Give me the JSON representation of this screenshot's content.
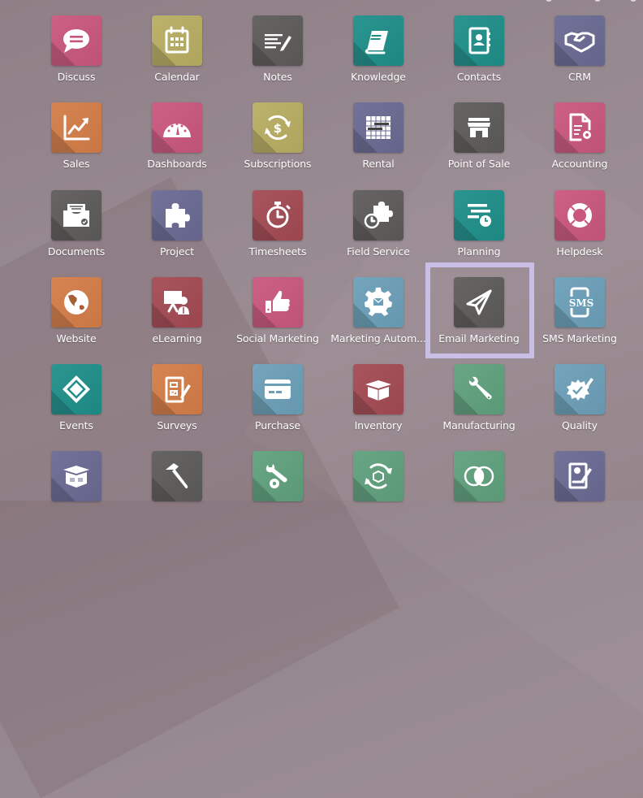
{
  "page": "Odoo app launcher",
  "highlighted_app": "Email Marketing",
  "highlight_color": "#c9bfe6",
  "apps": [
    {
      "label": "Discuss",
      "icon": "chat-bubble-icon",
      "color": "#c9577d"
    },
    {
      "label": "Calendar",
      "icon": "calendar-icon",
      "color": "#b8ad62"
    },
    {
      "label": "Notes",
      "icon": "notes-pencil-icon",
      "color": "#5d5b59"
    },
    {
      "label": "Knowledge",
      "icon": "book-icon",
      "color": "#1e8e89"
    },
    {
      "label": "Contacts",
      "icon": "address-book-icon",
      "color": "#1e8e89"
    },
    {
      "label": "CRM",
      "icon": "handshake-icon",
      "color": "#6a6a93"
    },
    {
      "label": "Sales",
      "icon": "chart-up-icon",
      "color": "#d37d47"
    },
    {
      "label": "Dashboards",
      "icon": "gauge-icon",
      "color": "#c9577d"
    },
    {
      "label": "Subscriptions",
      "icon": "recurring-dollar-icon",
      "color": "#b8ad62"
    },
    {
      "label": "Rental",
      "icon": "gantt-icon",
      "color": "#6a6a93"
    },
    {
      "label": "Point of Sale",
      "icon": "shop-icon",
      "color": "#5d5b59"
    },
    {
      "label": "Accounting",
      "icon": "document-gear-icon",
      "color": "#c9577d"
    },
    {
      "label": "Documents",
      "icon": "inbox-tray-icon",
      "color": "#5d5b59"
    },
    {
      "label": "Project",
      "icon": "puzzle-icon",
      "color": "#6a6a93"
    },
    {
      "label": "Timesheets",
      "icon": "stopwatch-icon",
      "color": "#a34a53"
    },
    {
      "label": "Field Service",
      "icon": "puzzle-stopwatch-icon",
      "color": "#5d5b59"
    },
    {
      "label": "Planning",
      "icon": "planning-lines-icon",
      "color": "#1e8e89"
    },
    {
      "label": "Helpdesk",
      "icon": "lifebuoy-icon",
      "color": "#c9577d"
    },
    {
      "label": "Website",
      "icon": "globe-icon",
      "color": "#d37d47"
    },
    {
      "label": "eLearning",
      "icon": "presentation-icon",
      "color": "#a34a53"
    },
    {
      "label": "Social Marketing",
      "icon": "thumbs-up-icon",
      "color": "#c9577d"
    },
    {
      "label": "Marketing Autom...",
      "icon": "gear-envelope-icon",
      "color": "#6b9fb8"
    },
    {
      "label": "Email Marketing",
      "icon": "paper-plane-icon",
      "color": "#5d5b59"
    },
    {
      "label": "SMS Marketing",
      "icon": "sms-phone-icon",
      "color": "#6b9fb8"
    },
    {
      "label": "Events",
      "icon": "ticket-icon",
      "color": "#1e8e89"
    },
    {
      "label": "Surveys",
      "icon": "checklist-pencil-icon",
      "color": "#d37d47"
    },
    {
      "label": "Purchase",
      "icon": "credit-card-icon",
      "color": "#6b9fb8"
    },
    {
      "label": "Inventory",
      "icon": "open-box-icon",
      "color": "#a34a53"
    },
    {
      "label": "Manufacturing",
      "icon": "wrench-icon",
      "color": "#5fa07d"
    },
    {
      "label": "Quality",
      "icon": "badge-check-pencil-icon",
      "color": "#6b9fb8"
    },
    {
      "label": "",
      "icon": "barcode-box-icon",
      "color": "#6a6a93"
    },
    {
      "label": "",
      "icon": "hammer-icon",
      "color": "#5d5b59"
    },
    {
      "label": "",
      "icon": "wrench-gear-icon",
      "color": "#5fa07d"
    },
    {
      "label": "",
      "icon": "recycle-box-icon",
      "color": "#5fa07d"
    },
    {
      "label": "",
      "icon": "venn-circles-icon",
      "color": "#5fa07d"
    },
    {
      "label": "",
      "icon": "sign-document-icon",
      "color": "#6a6a93"
    }
  ]
}
